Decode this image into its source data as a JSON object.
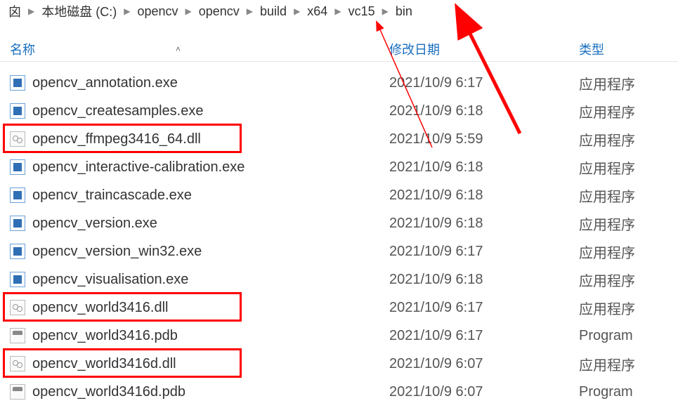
{
  "breadcrumb": {
    "items": [
      {
        "label": "囟"
      },
      {
        "label": "本地磁盘 (C:)"
      },
      {
        "label": "opencv"
      },
      {
        "label": "opencv"
      },
      {
        "label": "build"
      },
      {
        "label": "x64"
      },
      {
        "label": "vc15"
      },
      {
        "label": "bin"
      }
    ]
  },
  "columns": {
    "name": "名称",
    "date": "修改日期",
    "type": "类型"
  },
  "files": [
    {
      "name": "opencv_annotation.exe",
      "date": "2021/10/9 6:17",
      "type": "应用程序",
      "icon": "exe",
      "highlight": false
    },
    {
      "name": "opencv_createsamples.exe",
      "date": "2021/10/9 6:18",
      "type": "应用程序",
      "icon": "exe",
      "highlight": false
    },
    {
      "name": "opencv_ffmpeg3416_64.dll",
      "date": "2021/10/9 5:59",
      "type": "应用程序",
      "icon": "dll",
      "highlight": true
    },
    {
      "name": "opencv_interactive-calibration.exe",
      "date": "2021/10/9 6:18",
      "type": "应用程序",
      "icon": "exe",
      "highlight": false
    },
    {
      "name": "opencv_traincascade.exe",
      "date": "2021/10/9 6:18",
      "type": "应用程序",
      "icon": "exe",
      "highlight": false
    },
    {
      "name": "opencv_version.exe",
      "date": "2021/10/9 6:18",
      "type": "应用程序",
      "icon": "exe",
      "highlight": false
    },
    {
      "name": "opencv_version_win32.exe",
      "date": "2021/10/9 6:17",
      "type": "应用程序",
      "icon": "exe",
      "highlight": false
    },
    {
      "name": "opencv_visualisation.exe",
      "date": "2021/10/9 6:18",
      "type": "应用程序",
      "icon": "exe",
      "highlight": false
    },
    {
      "name": "opencv_world3416.dll",
      "date": "2021/10/9 6:17",
      "type": "应用程序",
      "icon": "dll",
      "highlight": true
    },
    {
      "name": "opencv_world3416.pdb",
      "date": "2021/10/9 6:17",
      "type": "Program",
      "icon": "pdb",
      "highlight": false
    },
    {
      "name": "opencv_world3416d.dll",
      "date": "2021/10/9 6:07",
      "type": "应用程序",
      "icon": "dll",
      "highlight": true
    },
    {
      "name": "opencv_world3416d.pdb",
      "date": "2021/10/9 6:07",
      "type": "Program",
      "icon": "pdb",
      "highlight": false
    }
  ],
  "annotations": {
    "arrow_color": "#ff0000",
    "highlight_color": "#ff0000"
  }
}
